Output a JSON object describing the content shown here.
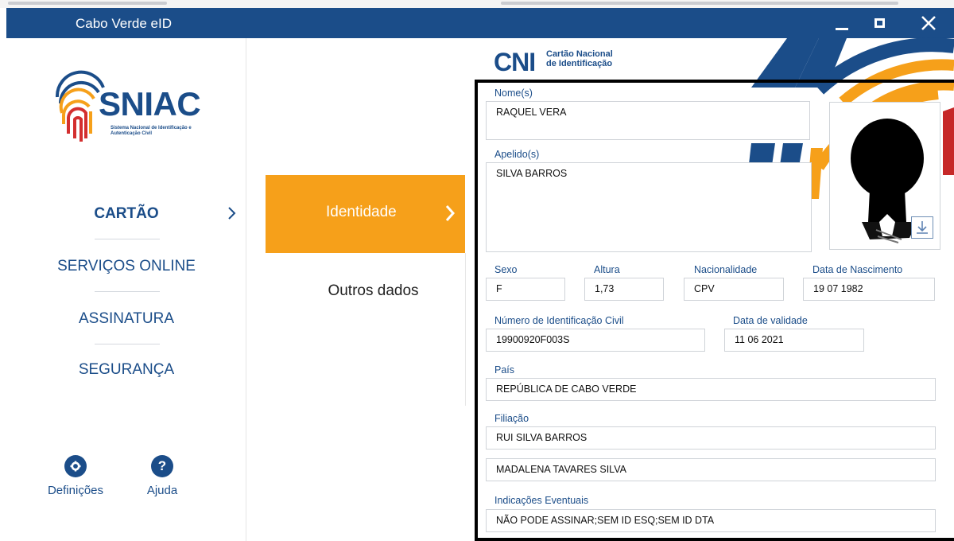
{
  "window": {
    "title": "Cabo Verde eID"
  },
  "logo": {
    "name": "SNIAC",
    "subtitle": "Sistema Nacional de Identificação e Autenticação Civil"
  },
  "nav": {
    "items": [
      {
        "label": "CARTÃO",
        "active": true
      },
      {
        "label": "SERVIÇOS ONLINE",
        "active": false
      },
      {
        "label": "ASSINATURA",
        "active": false
      },
      {
        "label": "SEGURANÇA",
        "active": false
      }
    ],
    "settings_label": "Definições",
    "help_label": "Ajuda",
    "settings_icon": "gear-icon",
    "help_icon": "question-icon"
  },
  "tabs": {
    "identity": "Identidade",
    "other": "Outros dados"
  },
  "card_header": {
    "brand": "CNI",
    "line1": "Cartão Nacional",
    "line2": "de Identificação"
  },
  "fields": {
    "nomes": {
      "label": "Nome(s)",
      "value": "RAQUEL VERA"
    },
    "apelidos": {
      "label": "Apelido(s)",
      "value": "SILVA BARROS"
    },
    "sexo": {
      "label": "Sexo",
      "value": "F"
    },
    "altura": {
      "label": "Altura",
      "value": "1,73"
    },
    "nacionalidade": {
      "label": "Nacionalidade",
      "value": "CPV"
    },
    "data_nascimento": {
      "label": "Data de Nascimento",
      "value": "19 07 1982"
    },
    "numero_id": {
      "label": "Número de Identificação Civil",
      "value": "19900920F003S"
    },
    "data_validade": {
      "label": "Data de validade",
      "value": "11 06 2021"
    },
    "pais": {
      "label": "País",
      "value": "REPÚBLICA DE CABO VERDE"
    },
    "filiacao": {
      "label": "Filiação",
      "pai": "RUI SILVA BARROS",
      "mae": "MADALENA TAVARES SILVA"
    },
    "indicacoes": {
      "label": "Indicações Eventuais",
      "value": "NÃO PODE ASSINAR;SEM ID ESQ;SEM ID DTA"
    }
  },
  "colors": {
    "brand_blue": "#1b4d89",
    "accent_orange": "#f6a01a",
    "accent_red": "#c62828"
  }
}
